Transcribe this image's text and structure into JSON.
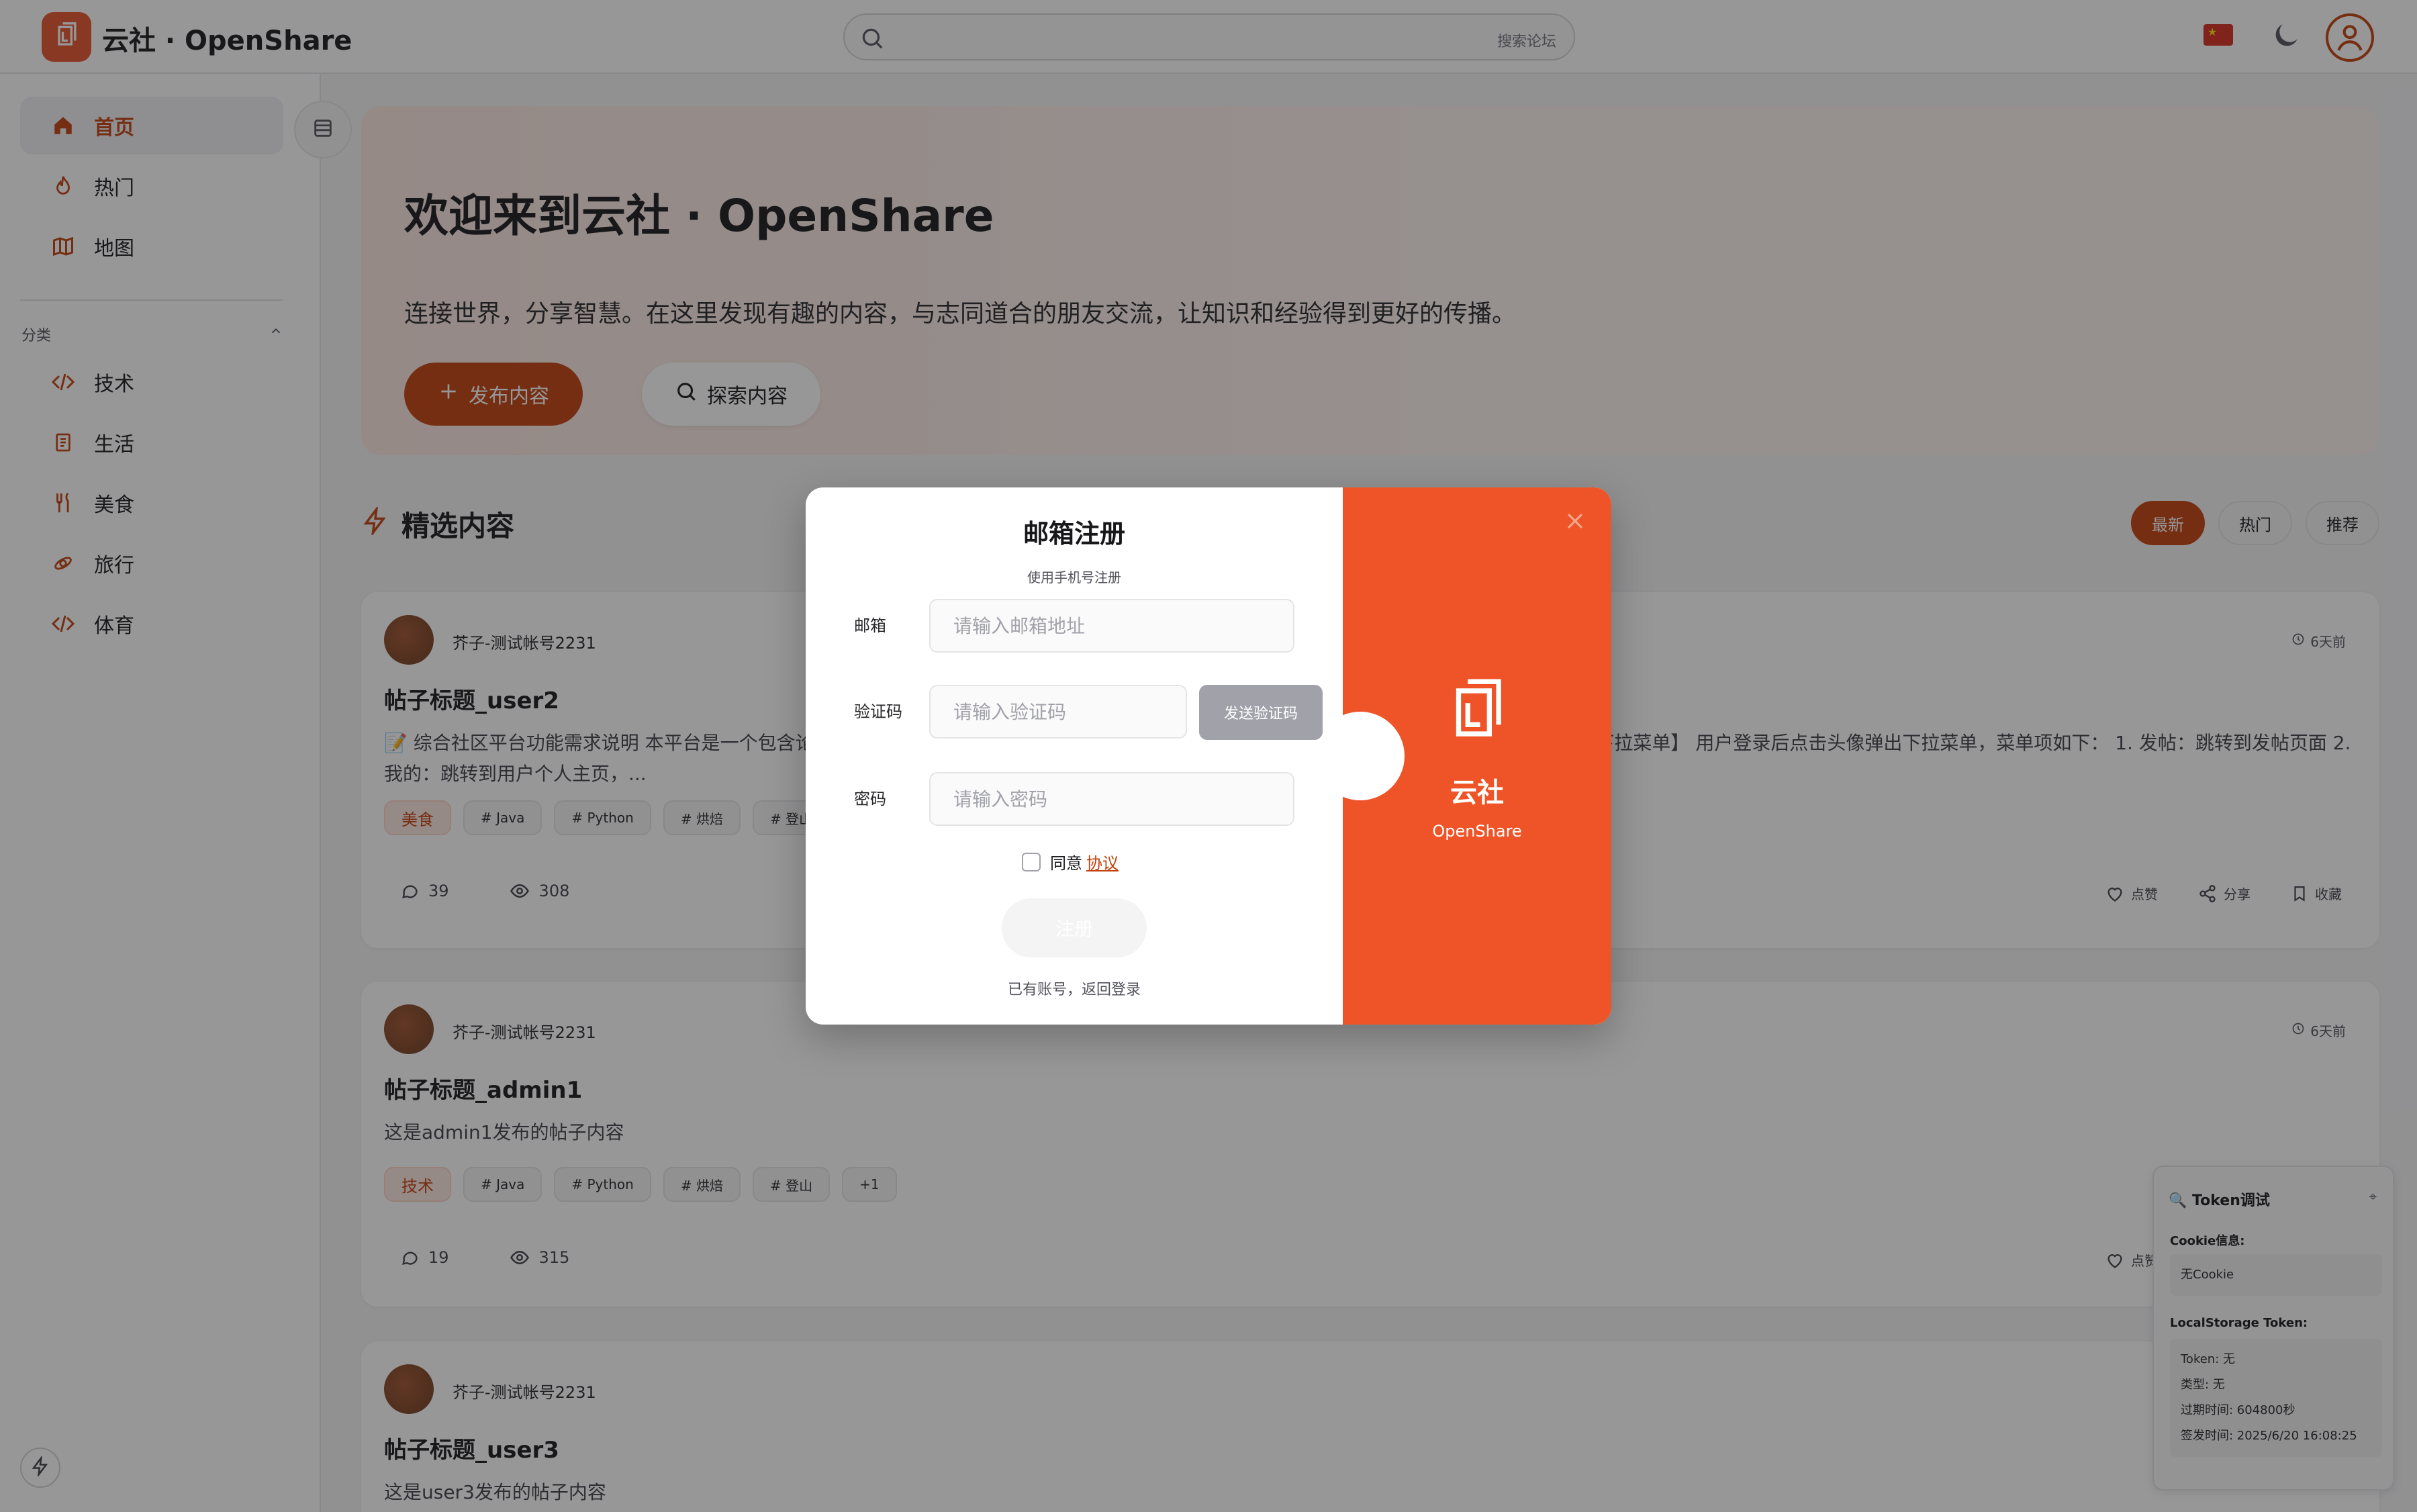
{
  "header": {
    "brand": "云社 · OpenShare",
    "search_placeholder": "搜索论坛"
  },
  "sidebar": {
    "items": [
      {
        "label": "首页",
        "icon": "home-icon",
        "active": true
      },
      {
        "label": "热门",
        "icon": "flame-icon"
      },
      {
        "label": "地图",
        "icon": "map-icon"
      }
    ],
    "category_title": "分类",
    "categories": [
      {
        "label": "技术",
        "icon": "code-icon"
      },
      {
        "label": "生活",
        "icon": "receipt-icon"
      },
      {
        "label": "美食",
        "icon": "utensils-icon"
      },
      {
        "label": "旅行",
        "icon": "plane-icon"
      },
      {
        "label": "体育",
        "icon": "code-icon"
      }
    ]
  },
  "hero": {
    "title": "欢迎来到云社 · OpenShare",
    "subtitle": "连接世界，分享智慧。在这里发现有趣的内容，与志同道合的朋友交流，让知识和经验得到更好的传播。",
    "publish_label": "发布内容",
    "explore_label": "探索内容"
  },
  "feed": {
    "section_title": "精选内容",
    "tabs": [
      "最新",
      "热门",
      "推荐"
    ],
    "active_tab": "最新",
    "posts": [
      {
        "author": "芥子-测试帐号2231",
        "time": "6天前",
        "title": "帖子标题_user2",
        "body": "📝 综合社区平台功能需求说明 本平台是一个包含论坛、商城、个人主页、地图等多功能的综合社区平台，具体需求如下：一、通用功能 👤【头像下拉菜单】 用户登录后点击头像弹出下拉菜单，菜单项如下： 1. 发帖：跳转到发帖页面 2. 我的：跳转到用户个人主页，...",
        "category": "美食",
        "tags": [
          "# Java",
          "# Python",
          "# 烘焙",
          "# 登山"
        ],
        "comments": "39",
        "views": "308"
      },
      {
        "author": "芥子-测试帐号2231",
        "time": "6天前",
        "title": "帖子标题_admin1",
        "body": "这是admin1发布的帖子内容",
        "category": "技术",
        "tags": [
          "# Java",
          "# Python",
          "# 烘焙",
          "# 登山",
          "+1"
        ],
        "comments": "19",
        "views": "315"
      },
      {
        "author": "芥子-测试帐号2231",
        "title": "帖子标题_user3",
        "body": "这是user3发布的帖子内容"
      }
    ],
    "actions": {
      "like": "点赞",
      "share": "分享",
      "collect": "收藏"
    }
  },
  "modal": {
    "title": "邮箱注册",
    "switch_link": "使用手机号注册",
    "email_label": "邮箱",
    "email_placeholder": "请输入邮箱地址",
    "code_label": "验证码",
    "code_placeholder": "请输入验证码",
    "send_code_label": "发送验证码",
    "password_label": "密码",
    "password_placeholder": "请输入密码",
    "agree_text": "同意",
    "agreement_link": "协议",
    "register_label": "注册",
    "back_to_login": "已有账号，返回登录",
    "panel_title": "云社",
    "panel_subtitle": "OpenShare",
    "accent_color": "#ee5427"
  },
  "token_debug": {
    "title": "🔍 Token调试",
    "pin_icon": "pin-icon",
    "cookie_label": "Cookie信息:",
    "cookie_value": "无Cookie",
    "storage_label": "LocalStorage Token:",
    "token_line": "Token: 无",
    "type_line": "类型: 无",
    "expire_line": "过期时间: 604800秒",
    "issued_line": "签发时间: 2025/6/20 16:08:25"
  }
}
